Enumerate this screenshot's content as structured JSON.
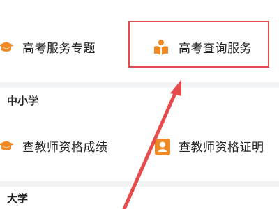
{
  "services": {
    "gaokao_topic": {
      "label": "高考服务专题",
      "icon": "graduation-cap-icon"
    },
    "gaokao_query": {
      "label": "高考查询服务",
      "icon": "open-book-reader-icon"
    }
  },
  "sections": {
    "primary_secondary": {
      "title": "中小学"
    },
    "university": {
      "title": "大学"
    }
  },
  "teacher_services": {
    "qualification_score": {
      "label": "查教师资格成绩",
      "icon": "graduation-cap-icon"
    },
    "qualification_certificate": {
      "label": "查教师资格证明",
      "icon": "id-badge-icon"
    }
  },
  "annotation": {
    "highlight_color": "#e74c4c",
    "accent_color": "#f08a24"
  }
}
